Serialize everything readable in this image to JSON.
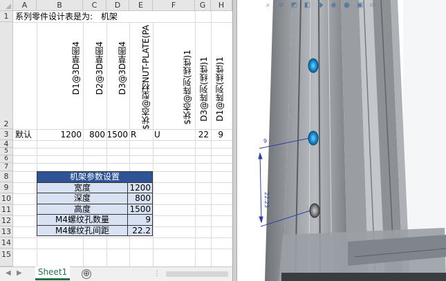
{
  "spreadsheet": {
    "columns": [
      "A",
      "B",
      "C",
      "D",
      "E",
      "F",
      "G",
      "H"
    ],
    "rows": [
      "1",
      "2",
      "3",
      "4",
      "5",
      "6",
      "7",
      "8",
      "9",
      "10",
      "11",
      "12",
      "13",
      "14",
      "15"
    ],
    "a1": "系列零件设计表是为:",
    "a1_value": "机架",
    "headers": [
      "D1@3D草图4",
      "D2@3D草图4",
      "D3@3D草图4",
      "$状态@型材NUT-PLATE(PA",
      "$状态@阵列(线性)1",
      "D3@阵列(线性)1",
      "D1@阵列(线性)1"
    ],
    "row3": {
      "name": "默认",
      "b": "1200",
      "c": "800",
      "d": "1500",
      "e": "R",
      "f": "U",
      "g": "22",
      "h": "9"
    },
    "param_table": {
      "title": "机架参数设置",
      "rows": [
        {
          "label": "宽度",
          "value": "1200"
        },
        {
          "label": "深度",
          "value": "800"
        },
        {
          "label": "高度",
          "value": "1500"
        },
        {
          "label": "M4螺纹孔数量",
          "value": "9"
        },
        {
          "label": "M4螺纹孔间距",
          "value": "22.2"
        }
      ]
    },
    "sheet_tab": "Sheet1",
    "add_sheet_symbol": "⊕"
  },
  "viewport": {
    "dimension_top": "9",
    "dimension_vertical": "22.23",
    "hole_color": "#1a8fd6",
    "toolbar_icons": [
      "search-icon",
      "zoom-icon",
      "view-icon",
      "section-icon",
      "display-icon",
      "hide-icon",
      "appearance-icon",
      "scene-icon",
      "monitor-icon"
    ]
  }
}
